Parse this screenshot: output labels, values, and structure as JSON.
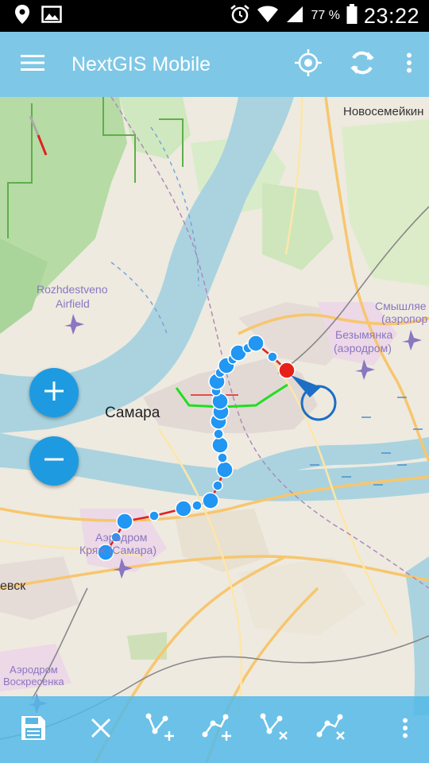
{
  "status_bar": {
    "icons": [
      "location-icon",
      "image-icon",
      "alarm-icon",
      "wifi-icon",
      "signal-icon",
      "battery-icon"
    ],
    "battery": "77 %",
    "time": "23:22"
  },
  "app_bar": {
    "title": "NextGIS Mobile",
    "icons": [
      "menu-icon",
      "locate-icon",
      "sync-icon",
      "more-vert-icon"
    ],
    "color": "#54bae8"
  },
  "map": {
    "labels": {
      "novosemeykino": "Новосемейкин",
      "rozhdestveno_1": "Rozhdestveno",
      "rozhdestveno_2": "Airfield",
      "smyshlyaevka_1": "Смышляе",
      "smyshlyaevka_2": "(аэропор",
      "bezymyanka_1": "Безымянка",
      "bezymyanka_2": "(аэродром)",
      "samara": "Самара",
      "krjazh_1": "Аэродром",
      "krjazh_2": "Кряж (Самара)",
      "left_edge": "евск",
      "voskresenka_1": "Аэродром",
      "voskresenka_2": "Воскресенка"
    },
    "colors": {
      "track_point": "#2196f3",
      "track_line": "#e0201e",
      "selected_point": "#e8201a",
      "green_line": "#22dd22",
      "water": "#aad3df"
    }
  },
  "controls": {
    "zoom_in": "+",
    "zoom_out": "−"
  },
  "bottom_bar": {
    "icons": [
      "save-icon",
      "close-icon",
      "add-point-icon",
      "add-point-end-icon",
      "delete-point-icon",
      "delete-line-icon",
      "more-vert-icon"
    ]
  }
}
